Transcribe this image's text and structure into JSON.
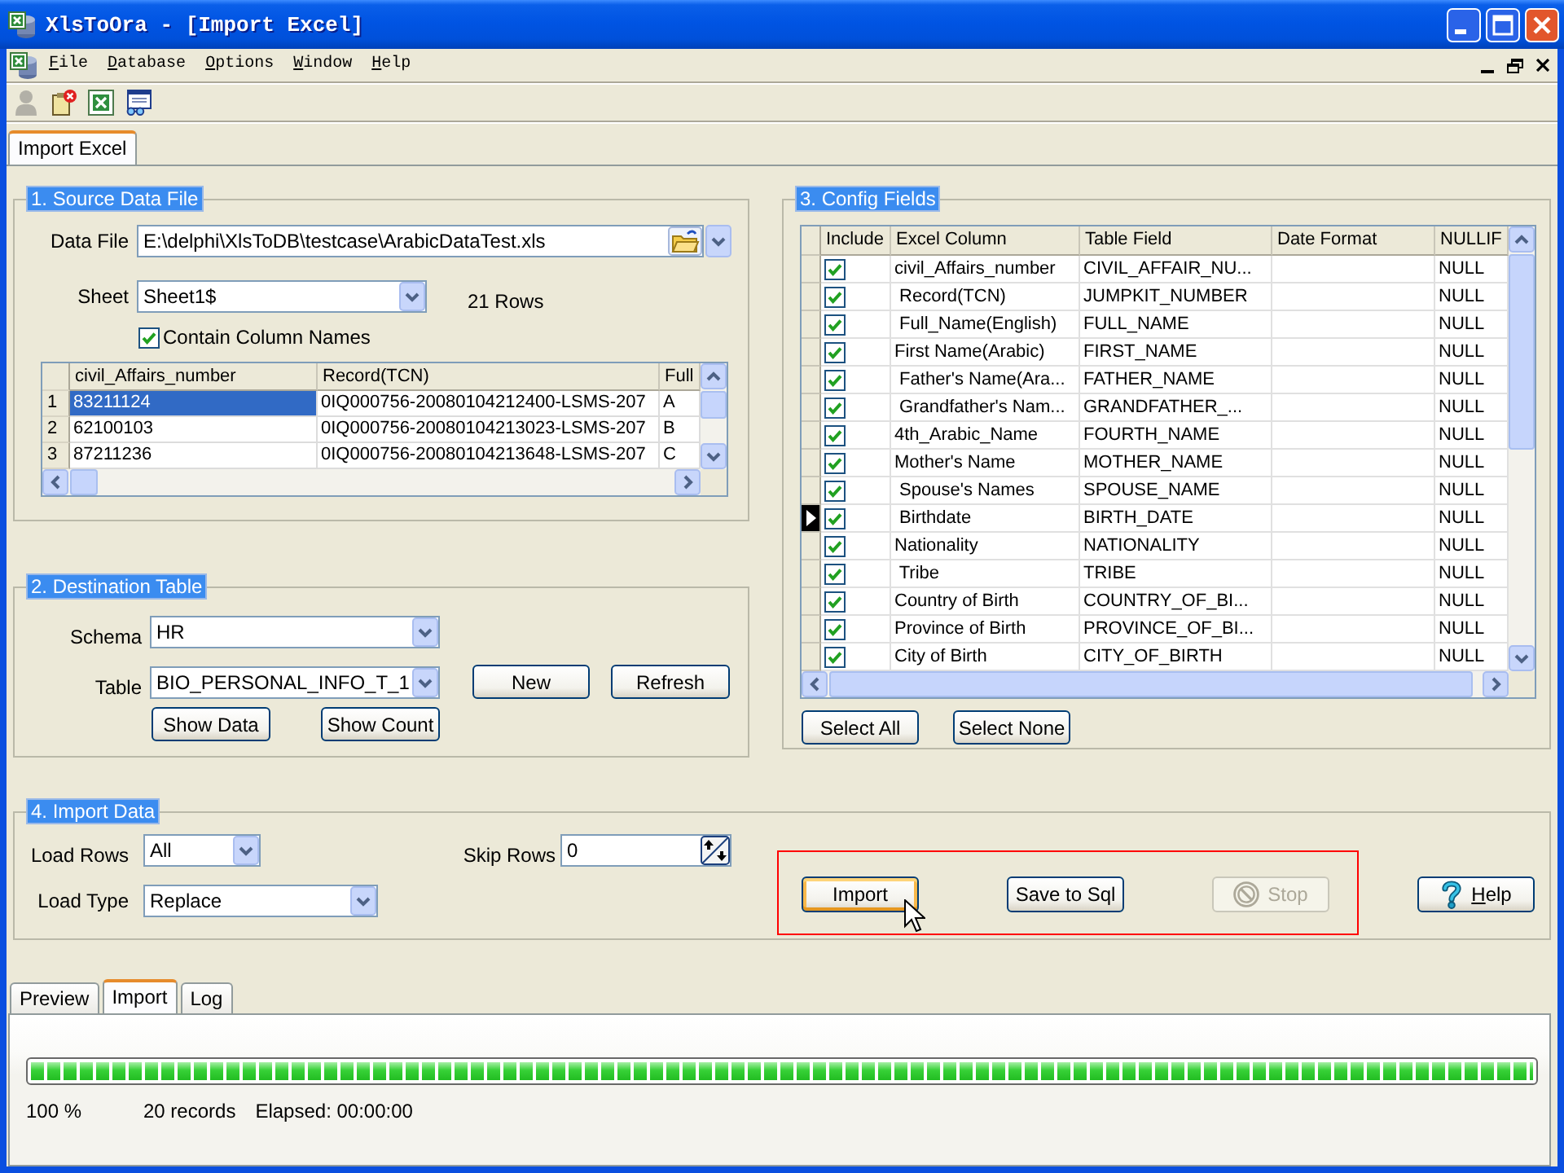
{
  "window": {
    "title": "XlsToOra - [Import Excel]"
  },
  "menu": [
    {
      "label": "File"
    },
    {
      "label": "Database"
    },
    {
      "label": "Options"
    },
    {
      "label": "Window"
    },
    {
      "label": "Help"
    }
  ],
  "toolbar": [
    {
      "disabled": true
    },
    {
      "disabled": false
    },
    {
      "disabled": false
    },
    {
      "disabled": false
    }
  ],
  "document_tabs": [
    {
      "label": "Import Excel",
      "selected": true
    }
  ],
  "source": {
    "title": "1. Source Data File",
    "data_file": {
      "label": "Data File",
      "value": "E:\\delphi\\XlsToDB\\testcase\\ArabicDataTest.xls"
    },
    "sheet": {
      "label": "Sheet",
      "value": "Sheet1$"
    },
    "row_count": "21 Rows",
    "contain_column_names": {
      "label": "Contain Column Names",
      "checked": true
    },
    "preview": {
      "columns": [
        "civil_Affairs_number",
        "Record(TCN)",
        "Full"
      ],
      "rows": [
        {
          "number": "1",
          "selected": true,
          "cells": [
            "83211124",
            "0IQ000756-20080104212400-LSMS-207",
            "A"
          ]
        },
        {
          "number": "2",
          "selected": false,
          "cells": [
            "62100103",
            "0IQ000756-20080104213023-LSMS-207",
            "B"
          ]
        },
        {
          "number": "3",
          "selected": false,
          "cells": [
            "87211236",
            "0IQ000756-20080104213648-LSMS-207",
            "C"
          ]
        }
      ]
    }
  },
  "destination": {
    "title": "2. Destination Table",
    "schema": {
      "label": "Schema",
      "value": "HR"
    },
    "table": {
      "label": "Table",
      "value": "BIO_PERSONAL_INFO_T_1"
    },
    "table_buttons": [
      {
        "label": "New"
      },
      {
        "label": "Refresh"
      }
    ],
    "view_buttons": [
      {
        "label": "Show Data"
      },
      {
        "label": "Show Count"
      }
    ]
  },
  "config": {
    "title": "3. Config Fields",
    "columns": [
      "Include",
      "Excel Column",
      "Table Field",
      "Date Format",
      "NULLIF"
    ],
    "rows": [
      {
        "include": true,
        "selected": false,
        "excel_column": "civil_Affairs_number",
        "table_field": "CIVIL_AFFAIR_NU...",
        "null_if": "NULL"
      },
      {
        "include": true,
        "selected": false,
        "excel_column": " Record(TCN)",
        "table_field": "JUMPKIT_NUMBER",
        "null_if": "NULL"
      },
      {
        "include": true,
        "selected": false,
        "excel_column": " Full_Name(English)",
        "table_field": "FULL_NAME",
        "null_if": "NULL"
      },
      {
        "include": true,
        "selected": false,
        "excel_column": "First Name(Arabic)",
        "table_field": "FIRST_NAME",
        "null_if": "NULL"
      },
      {
        "include": true,
        "selected": false,
        "excel_column": " Father's Name(Ara...",
        "table_field": "FATHER_NAME",
        "null_if": "NULL"
      },
      {
        "include": true,
        "selected": false,
        "excel_column": " Grandfather's Nam...",
        "table_field": "GRANDFATHER_...",
        "null_if": "NULL"
      },
      {
        "include": true,
        "selected": false,
        "excel_column": "4th_Arabic_Name",
        "table_field": "FOURTH_NAME",
        "null_if": "NULL"
      },
      {
        "include": true,
        "selected": false,
        "excel_column": "Mother's Name",
        "table_field": "MOTHER_NAME",
        "null_if": "NULL"
      },
      {
        "include": true,
        "selected": false,
        "excel_column": " Spouse's Names",
        "table_field": "SPOUSE_NAME",
        "null_if": "NULL"
      },
      {
        "include": true,
        "selected": true,
        "excel_column": " Birthdate",
        "table_field": "BIRTH_DATE",
        "null_if": "NULL"
      },
      {
        "include": true,
        "selected": false,
        "excel_column": "Nationality",
        "table_field": "NATIONALITY",
        "null_if": "NULL"
      },
      {
        "include": true,
        "selected": false,
        "excel_column": " Tribe",
        "table_field": "TRIBE",
        "null_if": "NULL"
      },
      {
        "include": true,
        "selected": false,
        "excel_column": "Country of Birth",
        "table_field": "COUNTRY_OF_BI...",
        "null_if": "NULL"
      },
      {
        "include": true,
        "selected": false,
        "excel_column": "Province of Birth",
        "table_field": "PROVINCE_OF_BI...",
        "null_if": "NULL"
      },
      {
        "include": true,
        "selected": false,
        "excel_column": "City of Birth",
        "table_field": "CITY_OF_BIRTH",
        "null_if": "NULL"
      }
    ],
    "buttons": [
      {
        "label": "Select All"
      },
      {
        "label": "Select None"
      }
    ]
  },
  "import": {
    "title": "4. Import Data",
    "load_rows": {
      "label": "Load Rows",
      "value": "All"
    },
    "load_type": {
      "label": "Load Type",
      "value": "Replace"
    },
    "skip_rows": {
      "label": "Skip Rows",
      "value": "0"
    },
    "highlighted": true,
    "actions": [
      {
        "label": "Import",
        "kind": "text",
        "focused": true,
        "disabled": false
      },
      {
        "label": "Save to Sql",
        "kind": "text",
        "focused": false,
        "disabled": false
      },
      {
        "label": "Stop",
        "kind": "icon",
        "focused": false,
        "disabled": true
      }
    ],
    "help": {
      "label": "Help"
    }
  },
  "log_tabs": [
    {
      "label": "Preview",
      "selected": false
    },
    {
      "label": "Import",
      "selected": true
    },
    {
      "label": "Log",
      "selected": false
    }
  ],
  "progress": {
    "level": 1,
    "percent": "100 %",
    "records": "20 records",
    "elapsed": "Elapsed: 00:00:00"
  }
}
